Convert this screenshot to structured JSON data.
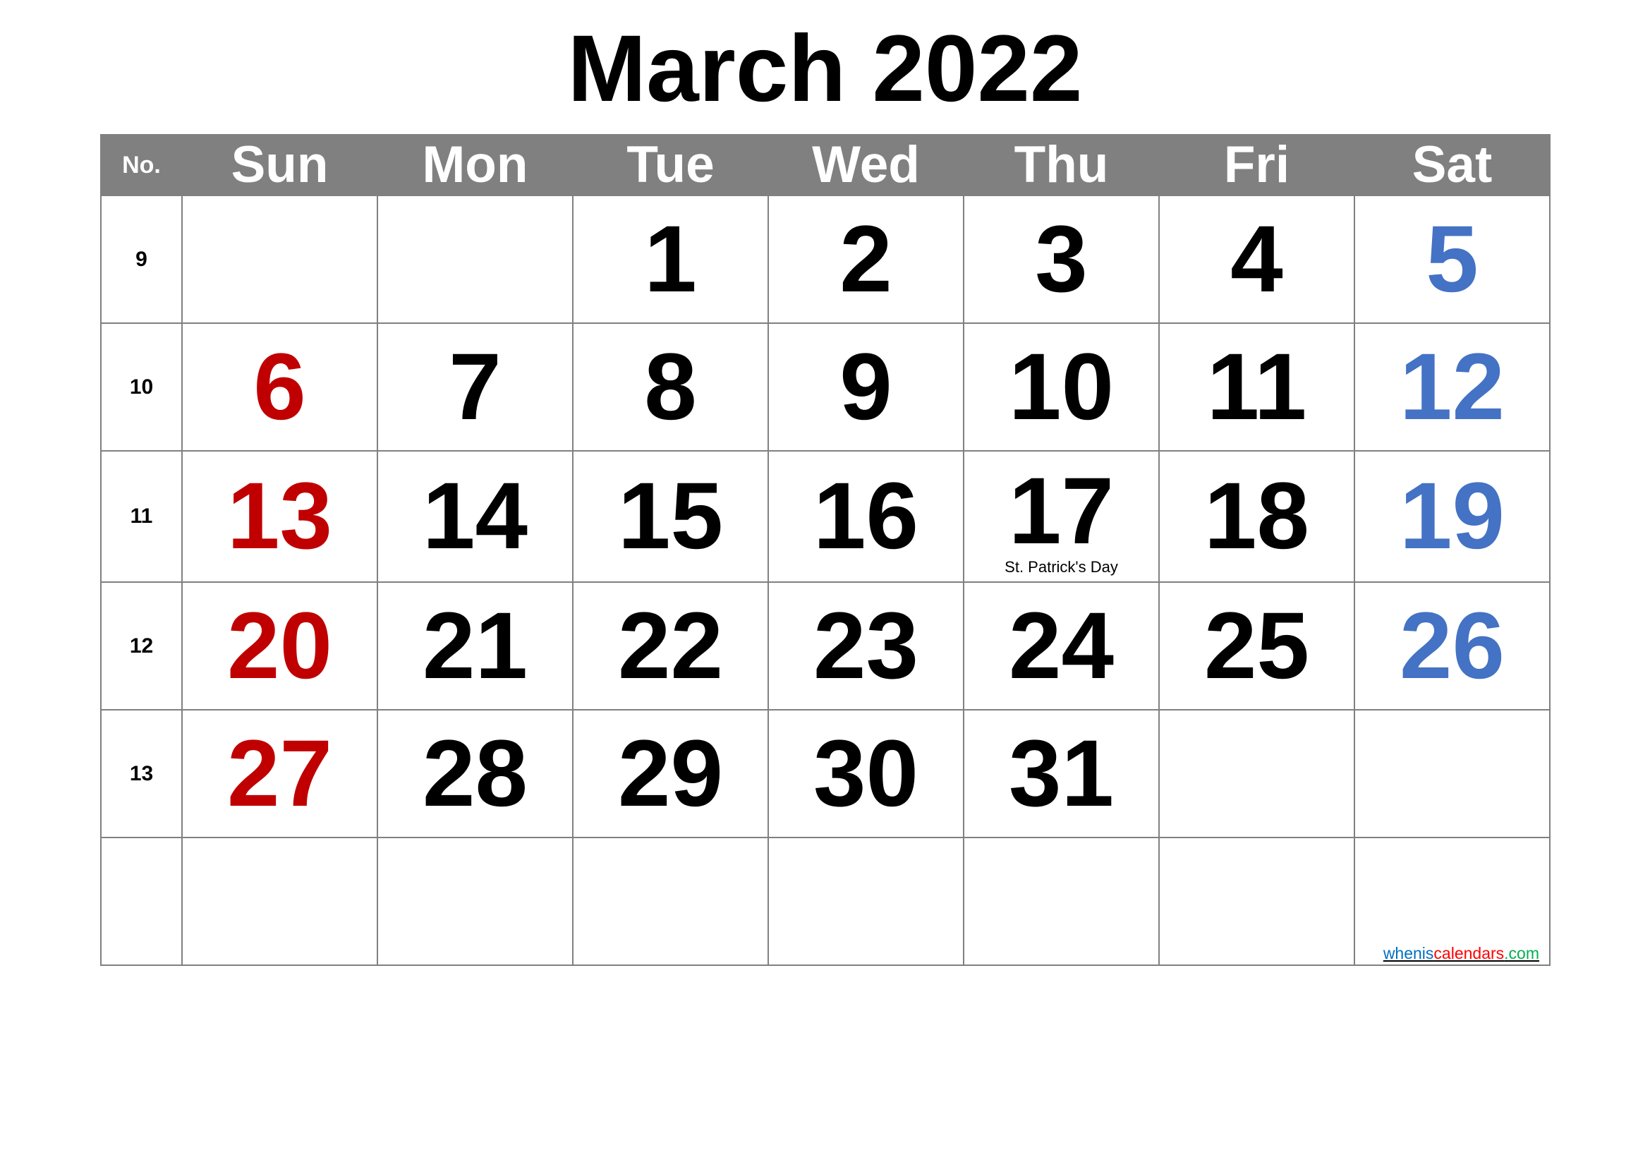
{
  "title": "March 2022",
  "header": {
    "no_label": "No.",
    "days": [
      "Sun",
      "Mon",
      "Tue",
      "Wed",
      "Thu",
      "Fri",
      "Sat"
    ]
  },
  "colors": {
    "header_bg": "#808080",
    "sunday": "#C00000",
    "saturday": "#4472C4",
    "weekday": "#000000"
  },
  "weeks": [
    {
      "no": "9",
      "days": [
        "",
        "",
        "1",
        "2",
        "3",
        "4",
        "5"
      ]
    },
    {
      "no": "10",
      "days": [
        "6",
        "7",
        "8",
        "9",
        "10",
        "11",
        "12"
      ]
    },
    {
      "no": "11",
      "days": [
        "13",
        "14",
        "15",
        "16",
        "17",
        "18",
        "19"
      ]
    },
    {
      "no": "12",
      "days": [
        "20",
        "21",
        "22",
        "23",
        "24",
        "25",
        "26"
      ]
    },
    {
      "no": "13",
      "days": [
        "27",
        "28",
        "29",
        "30",
        "31",
        "",
        ""
      ]
    },
    {
      "no": "",
      "days": [
        "",
        "",
        "",
        "",
        "",
        "",
        ""
      ]
    }
  ],
  "holidays": [
    {
      "date": "17",
      "label": "St. Patrick's Day"
    }
  ],
  "footer_link": {
    "part1": "whenis",
    "part2": "calendars",
    "part3": ".com"
  }
}
